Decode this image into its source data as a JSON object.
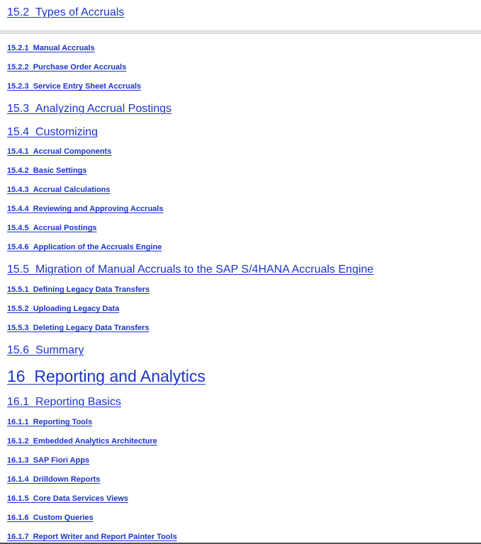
{
  "toc": {
    "entries": [
      {
        "number": "15.2",
        "title": "Types of Accruals",
        "level": 2
      },
      {
        "number": "15.2.1",
        "title": "Manual Accruals",
        "level": 3
      },
      {
        "number": "15.2.2",
        "title": "Purchase Order Accruals",
        "level": 3
      },
      {
        "number": "15.2.3",
        "title": "Service Entry Sheet Accruals",
        "level": 3
      },
      {
        "number": "15.3",
        "title": "Analyzing Accrual Postings",
        "level": 2
      },
      {
        "number": "15.4",
        "title": "Customizing",
        "level": 2
      },
      {
        "number": "15.4.1",
        "title": "Accrual Components",
        "level": 3
      },
      {
        "number": "15.4.2",
        "title": "Basic Settings",
        "level": 3
      },
      {
        "number": "15.4.3",
        "title": "Accrual Calculations",
        "level": 3
      },
      {
        "number": "15.4.4",
        "title": "Reviewing and Approving Accruals",
        "level": 3
      },
      {
        "number": "15.4.5",
        "title": "Accrual Postings",
        "level": 3
      },
      {
        "number": "15.4.6",
        "title": "Application of the Accruals Engine",
        "level": 3
      },
      {
        "number": "15.5",
        "title": "Migration of Manual Accruals to the SAP S/4HANA Accruals Engine",
        "level": 2
      },
      {
        "number": "15.5.1",
        "title": "Defining Legacy Data Transfers",
        "level": 3
      },
      {
        "number": "15.5.2",
        "title": "Uploading Legacy Data",
        "level": 3
      },
      {
        "number": "15.5.3",
        "title": "Deleting Legacy Data Transfers",
        "level": 3
      },
      {
        "number": "15.6",
        "title": "Summary",
        "level": 2
      },
      {
        "number": "16",
        "title": "Reporting and Analytics",
        "level": 1
      },
      {
        "number": "16.1",
        "title": "Reporting Basics",
        "level": 2
      },
      {
        "number": "16.1.1",
        "title": "Reporting Tools",
        "level": 3
      },
      {
        "number": "16.1.2",
        "title": "Embedded Analytics Architecture",
        "level": 3
      },
      {
        "number": "16.1.3",
        "title": "SAP Fiori Apps",
        "level": 3
      },
      {
        "number": "16.1.4",
        "title": "Drilldown Reports",
        "level": 3
      },
      {
        "number": "16.1.5",
        "title": "Core Data Services Views",
        "level": 3
      },
      {
        "number": "16.1.6",
        "title": "Custom Queries",
        "level": 3
      },
      {
        "number": "16.1.7",
        "title": "Report Writer and Report Painter Tools",
        "level": 3
      }
    ]
  },
  "colors": {
    "link": "#1a34c8",
    "divider": "#e6e6e6"
  }
}
